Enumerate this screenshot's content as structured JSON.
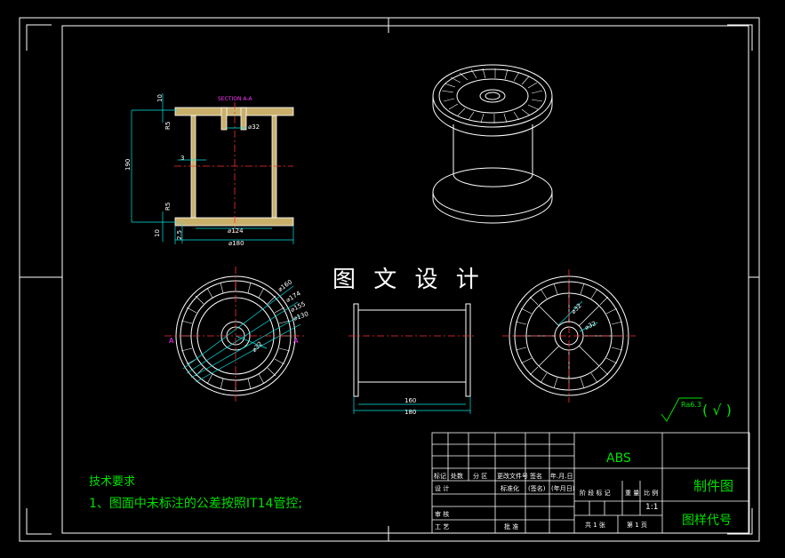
{
  "watermark": "图 文 设 计",
  "section_label": "SECTION A-A",
  "dimensions": {
    "d32_top": "⌀32",
    "d124": "⌀124",
    "d180": "⌀180",
    "h190": "190",
    "t10_top": "10",
    "t10_bottom": "10",
    "r3": "3",
    "r2_5": "2.5",
    "r15_top": "R5",
    "r15_bottom": "R5",
    "front_d160": "⌀160",
    "front_d174": "⌀174",
    "front_d155": "⌀155",
    "front_d130": "⌀130",
    "front_d32": "⌀32",
    "side_w160": "160",
    "side_w180": "180",
    "back_d32a": "⌀32",
    "back_d32b": "⌀32",
    "section_mark_left": "A",
    "section_mark_right": "A"
  },
  "tech_requirements": {
    "title": "技术要求",
    "item1": "1、图面中未标注的公差按照IT14管控;"
  },
  "roughness": {
    "value": "Ra6.3",
    "suffix": "( √ )"
  },
  "title_block": {
    "material": "ABS",
    "sheet_name": "制件图",
    "drawing_code": "图样代号",
    "scale": "1:1",
    "labels": {
      "mark": "标记",
      "count": "处数",
      "zone": "分 区",
      "change_doc": "更改文件号",
      "sign": "签名",
      "date": "年.月.日",
      "design": "设 计",
      "standard": "标准化",
      "sign2": "(签名)",
      "date2": "(年月日)",
      "stage": "阶 段 标 记",
      "weight": "重 量",
      "ratio": "比 例",
      "review": "审 核",
      "process": "工 艺",
      "approve": "批 准",
      "total": "共 1 张",
      "page": "第 1 页"
    }
  }
}
